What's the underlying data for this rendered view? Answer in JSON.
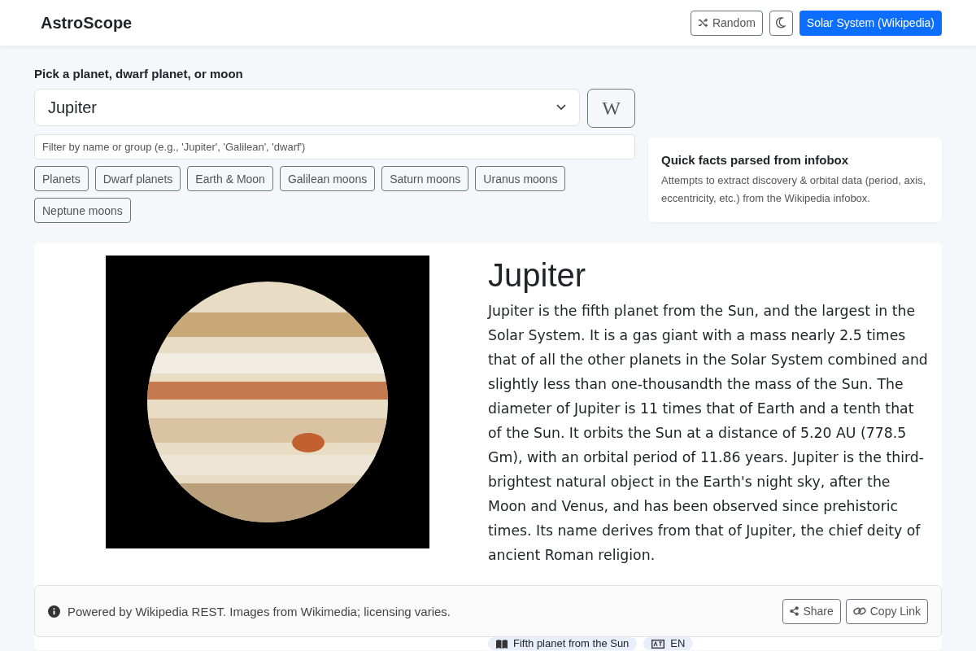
{
  "header": {
    "brand": "AstroScope",
    "random_button": "Random",
    "wiki_button": "Solar System (Wikipedia)"
  },
  "picker": {
    "label": "Pick a planet, dwarf planet, or moon",
    "value": "Jupiter",
    "wiki_icon_text": "W",
    "filter": {
      "placeholder": "Filter by name or group (e.g., 'Jupiter', 'Galilean', 'dwarf')"
    },
    "groups": [
      "Planets",
      "Dwarf planets",
      "Earth & Moon",
      "Galilean moons",
      "Saturn moons",
      "Uranus moons",
      "Neptune moons"
    ]
  },
  "quick_facts": {
    "title": "Quick facts parsed from infobox",
    "text": "Attempts to extract discovery & orbital data (period, axis, eccentricity, etc.) from the Wikipedia infobox."
  },
  "article": {
    "title": "Jupiter",
    "summary": "Jupiter is the fifth planet from the Sun, and the largest in the Solar System. It is a gas giant with a mass nearly 2.5 times that of all the other planets in the Solar System combined and slightly less than one-thousandth the mass of the Sun. The diameter of Jupiter is 11 times that of Earth and a tenth that of the Sun. It orbits the Sun at a distance of 5.20 AU (778.5 Gm), with an orbital period of 11.86 years. Jupiter is the third-brightest natural object in the Earth's night sky, after the Moon and Venus, and has been observed since prehistoric times. Its name derives from that of Jupiter, the chief deity of ancient Roman religion.",
    "badges": [
      {
        "kind": "description",
        "text": "Fifth planet from the Sun"
      },
      {
        "kind": "language",
        "text": "EN"
      }
    ]
  },
  "footer": {
    "text": "Powered by Wikipedia REST. Images from Wikimedia; licensing varies.",
    "share_button": "Share",
    "copy_button": "Copy Link"
  }
}
